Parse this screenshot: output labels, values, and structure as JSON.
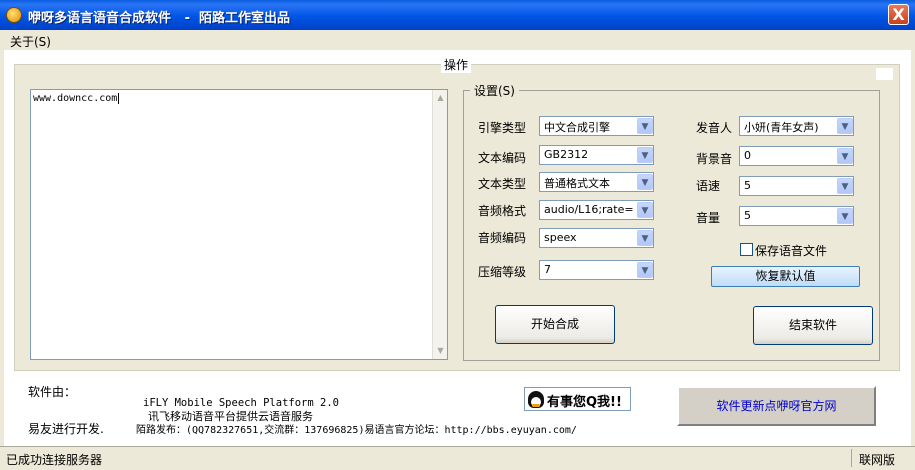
{
  "window": {
    "title": "咿呀多语言语音合成软件   -  陌路工作室出品",
    "close_label": "X"
  },
  "menu": {
    "about": "关于(S)"
  },
  "operations": {
    "legend": "操作",
    "text_content": "www.downcc.com"
  },
  "settings": {
    "legend": "设置(S)",
    "engine_type": {
      "label": "引擎类型",
      "value": "中文合成引擎"
    },
    "text_encoding": {
      "label": "文本编码",
      "value": "GB2312"
    },
    "text_type": {
      "label": "文本类型",
      "value": "普通格式文本"
    },
    "audio_format": {
      "label": "音频格式",
      "value": "audio/L16;rate="
    },
    "audio_codec": {
      "label": "音频编码",
      "value": "speex"
    },
    "compression": {
      "label": "压缩等级",
      "value": "7"
    },
    "speaker": {
      "label": "发音人",
      "value": "小妍(青年女声)"
    },
    "bg_sound": {
      "label": "背景音",
      "value": "0"
    },
    "speed": {
      "label": "语速",
      "value": "5"
    },
    "volume": {
      "label": "音量",
      "value": "5"
    },
    "save_audio": {
      "label": "保存语音文件",
      "checked": false
    },
    "restore_defaults": "恢复默认值",
    "start": "开始合成",
    "exit": "结束软件"
  },
  "footer": {
    "made_by": "软件由：",
    "platform": "iFLY Mobile Speech Platform 2.0",
    "service": "讯飞移动语音平台提供云语音服务",
    "dev": "易友进行开发.",
    "publish": "陌路发布：(QQ782327651,交流群：137696825)易语言官方论坛：http://bbs.eyuyan.com/",
    "qq": "有事您Q我!!",
    "update": "软件更新点咿呀官方网"
  },
  "status": {
    "left": "已成功连接服务器",
    "right": "联网版"
  },
  "colors": {
    "titlebar": "#0055e5",
    "face": "#ece9d8",
    "link_blue": "#0000cc"
  }
}
